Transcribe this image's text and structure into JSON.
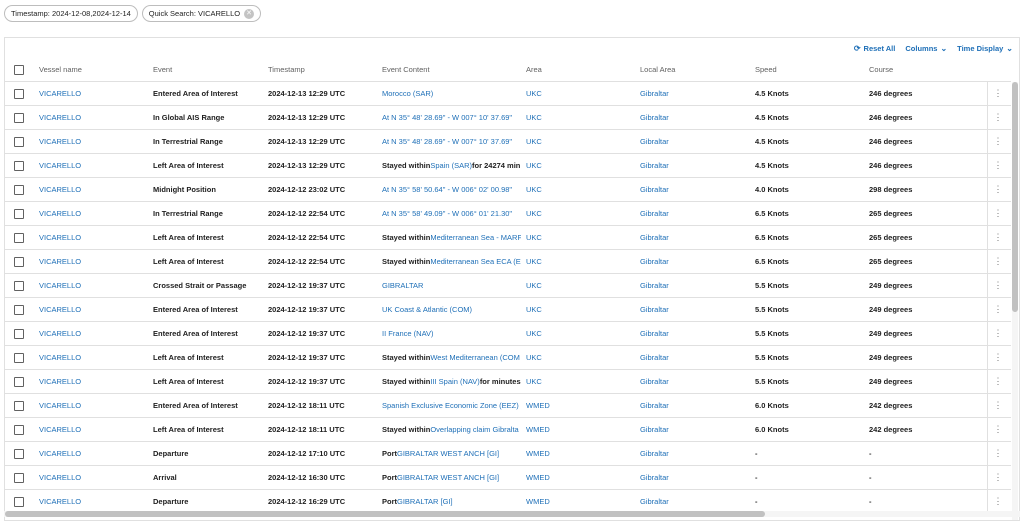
{
  "filters": {
    "timestamp_chip": "Timestamp: 2024-12-08,2024-12-14",
    "quick_search_chip": "Quick Search: VICARELLO",
    "clear_icon": "close-circle-icon"
  },
  "toolbar": {
    "reset_label": "Reset All",
    "columns_label": "Columns",
    "time_display_label": "Time Display"
  },
  "columns": {
    "vessel": "Vessel name",
    "event": "Event",
    "timestamp": "Timestamp",
    "content": "Event Content",
    "area": "Area",
    "local_area": "Local Area",
    "speed": "Speed",
    "course": "Course"
  },
  "colors": {
    "link": "#1e6fb7",
    "border": "#e0e0e0"
  },
  "rows": [
    {
      "vessel": "VICARELLO",
      "event": "Entered Area of Interest",
      "timestamp": "2024-12-13 12:29 UTC",
      "content_prefix": "",
      "content_link": "Morocco (SAR)",
      "content_suffix": "",
      "area": "UKC",
      "local_area": "Gibraltar",
      "speed": "4.5 Knots",
      "course": "246 degrees"
    },
    {
      "vessel": "VICARELLO",
      "event": "In Global AIS Range",
      "timestamp": "2024-12-13 12:29 UTC",
      "content_prefix": "",
      "content_link": "At N 35° 48' 28.69\" - W 007° 10' 37.69\"",
      "content_suffix": "",
      "area": "UKC",
      "local_area": "Gibraltar",
      "speed": "4.5 Knots",
      "course": "246 degrees"
    },
    {
      "vessel": "VICARELLO",
      "event": "In Terrestrial Range",
      "timestamp": "2024-12-13 12:29 UTC",
      "content_prefix": "",
      "content_link": "At N 35° 48' 28.69\" - W 007° 10' 37.69\"",
      "content_suffix": "",
      "area": "UKC",
      "local_area": "Gibraltar",
      "speed": "4.5 Knots",
      "course": "246 degrees"
    },
    {
      "vessel": "VICARELLO",
      "event": "Left Area of Interest",
      "timestamp": "2024-12-13 12:29 UTC",
      "content_prefix": "Stayed within ",
      "content_link": "Spain (SAR)",
      "content_suffix": " for 24274 min",
      "area": "UKC",
      "local_area": "Gibraltar",
      "speed": "4.5 Knots",
      "course": "246 degrees"
    },
    {
      "vessel": "VICARELLO",
      "event": "Midnight Position",
      "timestamp": "2024-12-12 23:02 UTC",
      "content_prefix": "",
      "content_link": "At N 35° 58' 50.64\" - W 006° 02' 00.98\"",
      "content_suffix": "",
      "area": "UKC",
      "local_area": "Gibraltar",
      "speed": "4.0 Knots",
      "course": "298 degrees"
    },
    {
      "vessel": "VICARELLO",
      "event": "In Terrestrial Range",
      "timestamp": "2024-12-12 22:54 UTC",
      "content_prefix": "",
      "content_link": "At N 35° 58' 49.09\" - W 006° 01' 21.30\"",
      "content_suffix": "",
      "area": "UKC",
      "local_area": "Gibraltar",
      "speed": "6.5 Knots",
      "course": "265 degrees"
    },
    {
      "vessel": "VICARELLO",
      "event": "Left Area of Interest",
      "timestamp": "2024-12-12 22:54 UTC",
      "content_prefix": "Stayed within ",
      "content_link": "Mediterranean Sea - MARF",
      "content_suffix": "",
      "area": "UKC",
      "local_area": "Gibraltar",
      "speed": "6.5 Knots",
      "course": "265 degrees"
    },
    {
      "vessel": "VICARELLO",
      "event": "Left Area of Interest",
      "timestamp": "2024-12-12 22:54 UTC",
      "content_prefix": "Stayed within ",
      "content_link": "Mediterranean Sea ECA (E",
      "content_suffix": "",
      "area": "UKC",
      "local_area": "Gibraltar",
      "speed": "6.5 Knots",
      "course": "265 degrees"
    },
    {
      "vessel": "VICARELLO",
      "event": "Crossed Strait or Passage",
      "timestamp": "2024-12-12 19:37 UTC",
      "content_prefix": "",
      "content_link": "GIBRALTAR",
      "content_suffix": "",
      "area": "UKC",
      "local_area": "Gibraltar",
      "speed": "5.5 Knots",
      "course": "249 degrees"
    },
    {
      "vessel": "VICARELLO",
      "event": "Entered Area of Interest",
      "timestamp": "2024-12-12 19:37 UTC",
      "content_prefix": "",
      "content_link": "UK Coast & Atlantic (COM)",
      "content_suffix": "",
      "area": "UKC",
      "local_area": "Gibraltar",
      "speed": "5.5 Knots",
      "course": "249 degrees"
    },
    {
      "vessel": "VICARELLO",
      "event": "Entered Area of Interest",
      "timestamp": "2024-12-12 19:37 UTC",
      "content_prefix": "",
      "content_link": "II France (NAV)",
      "content_suffix": "",
      "area": "UKC",
      "local_area": "Gibraltar",
      "speed": "5.5 Knots",
      "course": "249 degrees"
    },
    {
      "vessel": "VICARELLO",
      "event": "Left Area of Interest",
      "timestamp": "2024-12-12 19:37 UTC",
      "content_prefix": "Stayed within ",
      "content_link": "West Mediterranean (COM",
      "content_suffix": "",
      "area": "UKC",
      "local_area": "Gibraltar",
      "speed": "5.5 Knots",
      "course": "249 degrees"
    },
    {
      "vessel": "VICARELLO",
      "event": "Left Area of Interest",
      "timestamp": "2024-12-12 19:37 UTC",
      "content_prefix": "Stayed within ",
      "content_link": "III Spain (NAV)",
      "content_suffix": " for minutes",
      "area": "UKC",
      "local_area": "Gibraltar",
      "speed": "5.5 Knots",
      "course": "249 degrees"
    },
    {
      "vessel": "VICARELLO",
      "event": "Entered Area of Interest",
      "timestamp": "2024-12-12 18:11 UTC",
      "content_prefix": "",
      "content_link": "Spanish Exclusive Economic Zone (EEZ)",
      "content_suffix": "",
      "area": "WMED",
      "local_area": "Gibraltar",
      "speed": "6.0 Knots",
      "course": "242 degrees"
    },
    {
      "vessel": "VICARELLO",
      "event": "Left Area of Interest",
      "timestamp": "2024-12-12 18:11 UTC",
      "content_prefix": "Stayed within ",
      "content_link": "Overlapping claim Gibralta",
      "content_suffix": "",
      "area": "WMED",
      "local_area": "Gibraltar",
      "speed": "6.0 Knots",
      "course": "242 degrees"
    },
    {
      "vessel": "VICARELLO",
      "event": "Departure",
      "timestamp": "2024-12-12 17:10 UTC",
      "content_prefix": "Port ",
      "content_link": "GIBRALTAR WEST ANCH [GI]",
      "content_suffix": "",
      "area": "WMED",
      "local_area": "Gibraltar",
      "speed": "-",
      "course": "-"
    },
    {
      "vessel": "VICARELLO",
      "event": "Arrival",
      "timestamp": "2024-12-12 16:30 UTC",
      "content_prefix": "Port ",
      "content_link": "GIBRALTAR WEST ANCH [GI]",
      "content_suffix": "",
      "area": "WMED",
      "local_area": "Gibraltar",
      "speed": "-",
      "course": "-"
    },
    {
      "vessel": "VICARELLO",
      "event": "Departure",
      "timestamp": "2024-12-12 16:29 UTC",
      "content_prefix": "Port ",
      "content_link": "GIBRALTAR [GI]",
      "content_suffix": "",
      "area": "WMED",
      "local_area": "Gibraltar",
      "speed": "-",
      "course": "-"
    }
  ]
}
